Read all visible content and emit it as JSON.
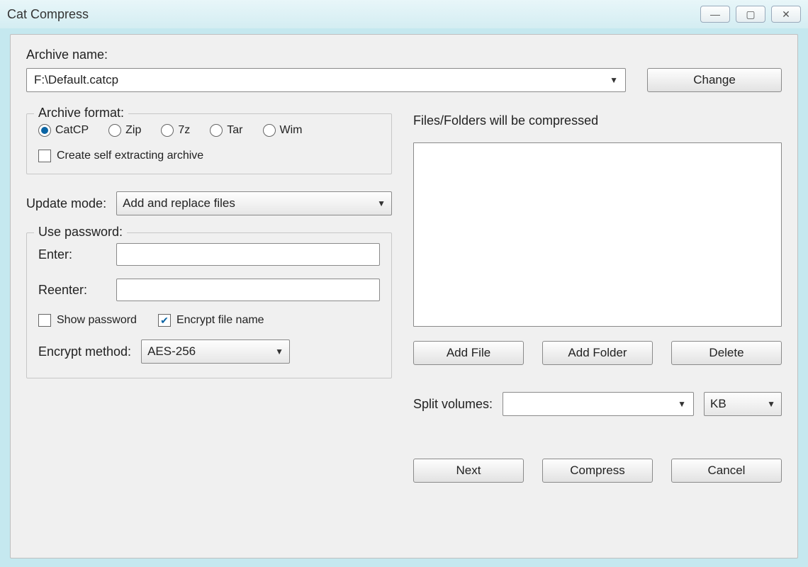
{
  "window": {
    "title": "Cat Compress"
  },
  "archiveName": {
    "label": "Archive name:",
    "value": "F:\\Default.catcp",
    "changeBtn": "Change"
  },
  "format": {
    "legend": "Archive format:",
    "options": {
      "catcp": "CatCP",
      "zip": "Zip",
      "sevenz": "7z",
      "tar": "Tar",
      "wim": "Wim"
    },
    "selected": "catcp",
    "selfExtractLabel": "Create self extracting archive",
    "selfExtractChecked": false
  },
  "updateMode": {
    "label": "Update mode:",
    "value": "Add and replace files"
  },
  "password": {
    "legend": "Use password:",
    "enterLabel": "Enter:",
    "reenterLabel": "Reenter:",
    "enterValue": "",
    "reenterValue": "",
    "showPasswordLabel": "Show password",
    "showPasswordChecked": false,
    "encryptNameLabel": "Encrypt file name",
    "encryptNameChecked": true,
    "methodLabel": "Encrypt method:",
    "methodValue": "AES-256"
  },
  "files": {
    "heading": "Files/Folders will be compressed",
    "addFile": "Add File",
    "addFolder": "Add Folder",
    "delete": "Delete"
  },
  "split": {
    "label": "Split volumes:",
    "value": "",
    "unit": "KB"
  },
  "actions": {
    "next": "Next",
    "compress": "Compress",
    "cancel": "Cancel"
  }
}
